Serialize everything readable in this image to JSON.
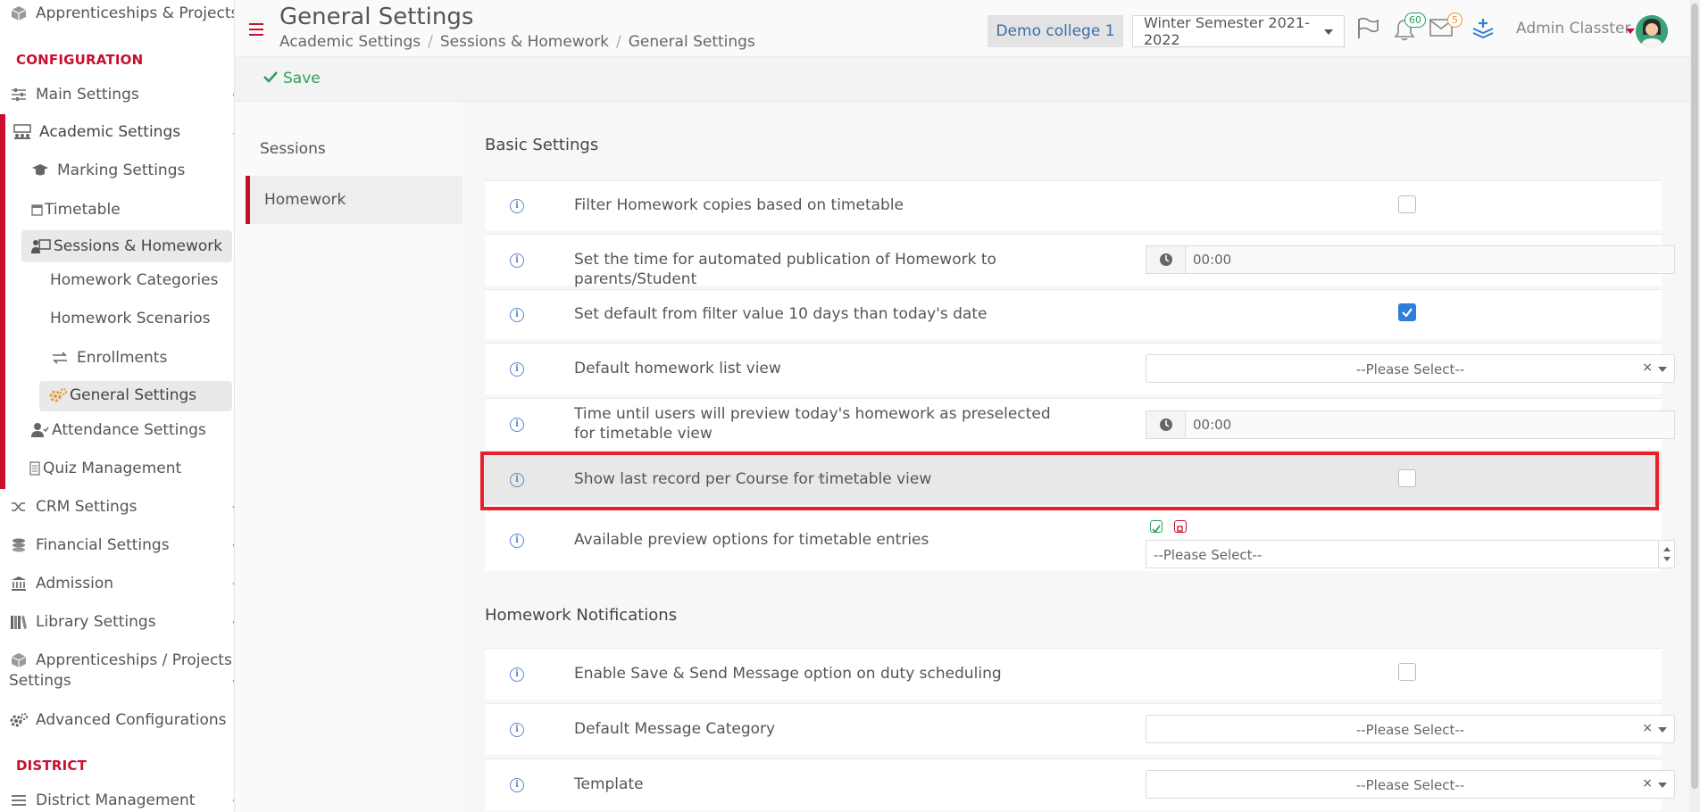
{
  "sidebar": {
    "items": [
      {
        "label": "Apprenticeships & Projects"
      },
      {
        "label": "Main Settings"
      },
      {
        "label": "Academic Settings"
      },
      {
        "label": "Marking Settings"
      },
      {
        "label": "Timetable"
      },
      {
        "label": "Sessions & Homework"
      },
      {
        "label": "Homework Categories"
      },
      {
        "label": "Homework Scenarios"
      },
      {
        "label": "Enrollments"
      },
      {
        "label": "General Settings"
      },
      {
        "label": "Attendance Settings"
      },
      {
        "label": "Quiz Management"
      },
      {
        "label": "CRM Settings"
      },
      {
        "label": "Financial Settings"
      },
      {
        "label": "Admission"
      },
      {
        "label": "Library Settings"
      },
      {
        "label": "Apprenticeships / Projects"
      },
      {
        "label": "Settings"
      },
      {
        "label": "Advanced Configurations"
      },
      {
        "label": "District Management"
      }
    ],
    "headings": {
      "configuration": "CONFIGURATION",
      "district": "DISTRICT"
    }
  },
  "header": {
    "title": "General Settings",
    "breadcrumbs": [
      "Academic Settings",
      "Sessions & Homework",
      "General Settings"
    ],
    "college": "Demo college 1",
    "semester": "Winter Semester 2021-2022",
    "notifications_count": "60",
    "messages_count": "5",
    "user": "Admin Classter"
  },
  "toolbar": {
    "save_label": "Save"
  },
  "tabs": [
    "Sessions",
    "Homework"
  ],
  "basic": {
    "title": "Basic Settings",
    "rows": [
      {
        "label": "Filter Homework copies based on timetable"
      },
      {
        "label": "Set the time for automated publication of Homework to parents/Student",
        "value": "00:00"
      },
      {
        "label": "Set default from filter value 10 days than today's date"
      },
      {
        "label": "Default homework list view",
        "placeholder": "--Please Select--"
      },
      {
        "label": "Time until users will preview today's homework as preselected for timetable view",
        "value": "00:00"
      },
      {
        "label": "Show last record per Course for timetable view",
        "dots": "···"
      },
      {
        "label": "Available preview options for timetable entries",
        "placeholder": "--Please Select--"
      }
    ]
  },
  "notifications": {
    "title": "Homework Notifications",
    "rows": [
      {
        "label": "Enable Save & Send Message option on duty scheduling"
      },
      {
        "label": "Default Message Category",
        "placeholder": "--Please Select--"
      },
      {
        "label": "Template",
        "placeholder": "--Please Select--"
      }
    ]
  },
  "common": {
    "info_glyph": "i",
    "clear_glyph": "×",
    "chevron": "‹",
    "chevron_down": "⌄"
  },
  "colors": {
    "accent": "#c8102e",
    "save": "#2e9e5f",
    "checkbox_on": "#2d7fd8",
    "highlight_border": "#e8202a"
  }
}
